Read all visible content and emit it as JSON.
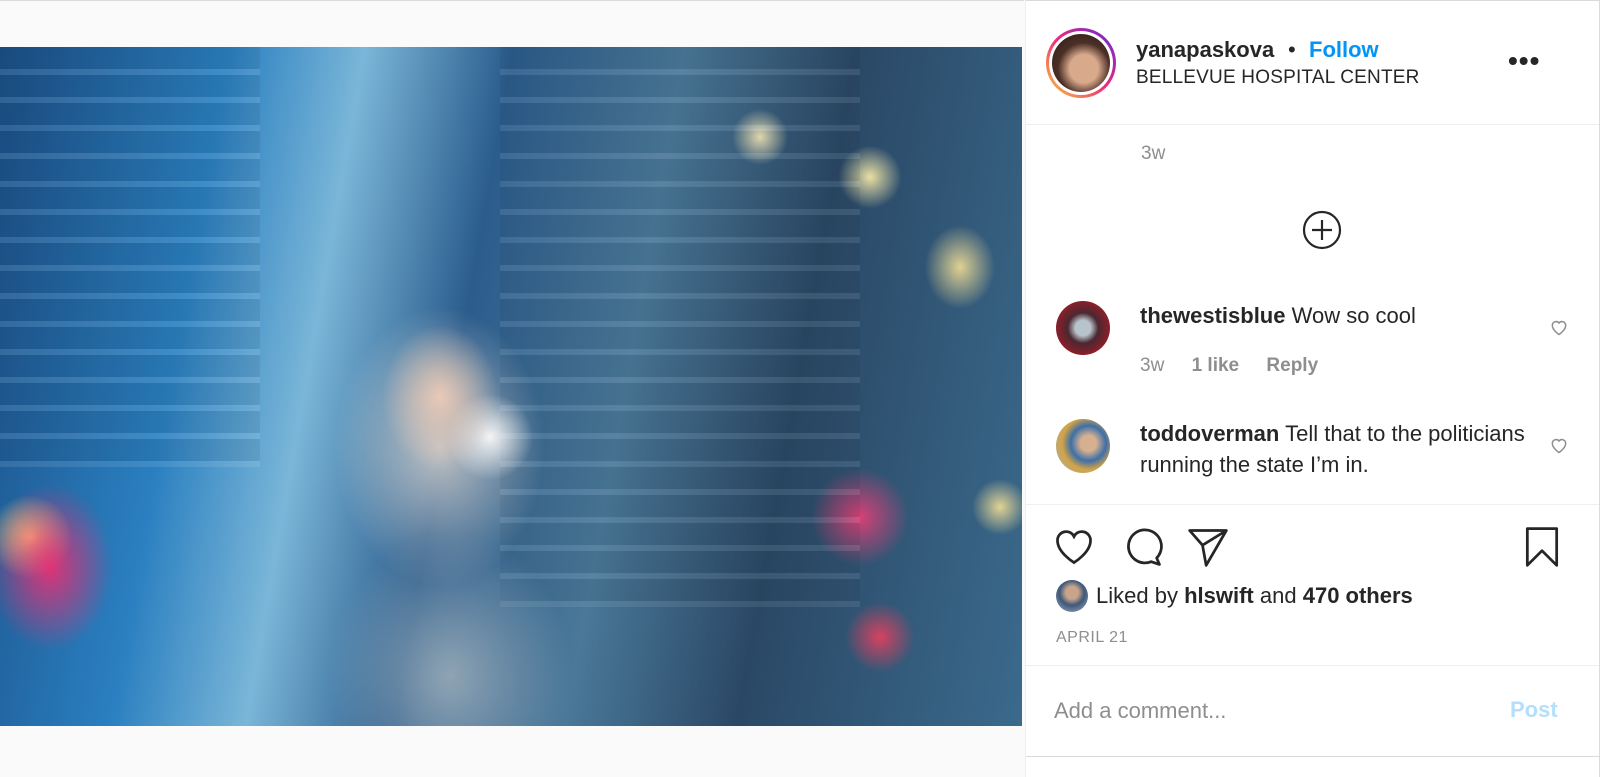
{
  "header": {
    "username": "yanapaskova",
    "separator": "•",
    "follow_label": "Follow",
    "location": "BELLEVUE HOSPITAL CENTER",
    "more_label": "•••"
  },
  "caption": {
    "time": "3w"
  },
  "comments": [
    {
      "username": "thewestisblue",
      "text": "Wow so cool",
      "time": "3w",
      "likes": "1 like",
      "reply_label": "Reply"
    },
    {
      "username": "toddoverman",
      "text": "Tell that to the politicians running the state I’m in."
    }
  ],
  "likes": {
    "prefix": "Liked by",
    "user": "hlswift",
    "conj": "and",
    "others": "470 others"
  },
  "date": "APRIL 21",
  "comment_box": {
    "placeholder": "Add a comment...",
    "post_label": "Post"
  },
  "colors": {
    "link": "#0095f6",
    "post_disabled": "#b2dffc",
    "muted": "#8e8e8e"
  },
  "icons": {
    "load_more": "plus-circle-icon",
    "like": "heart-icon",
    "comment": "comment-bubble-icon",
    "share": "paper-plane-icon",
    "save": "bookmark-icon"
  }
}
